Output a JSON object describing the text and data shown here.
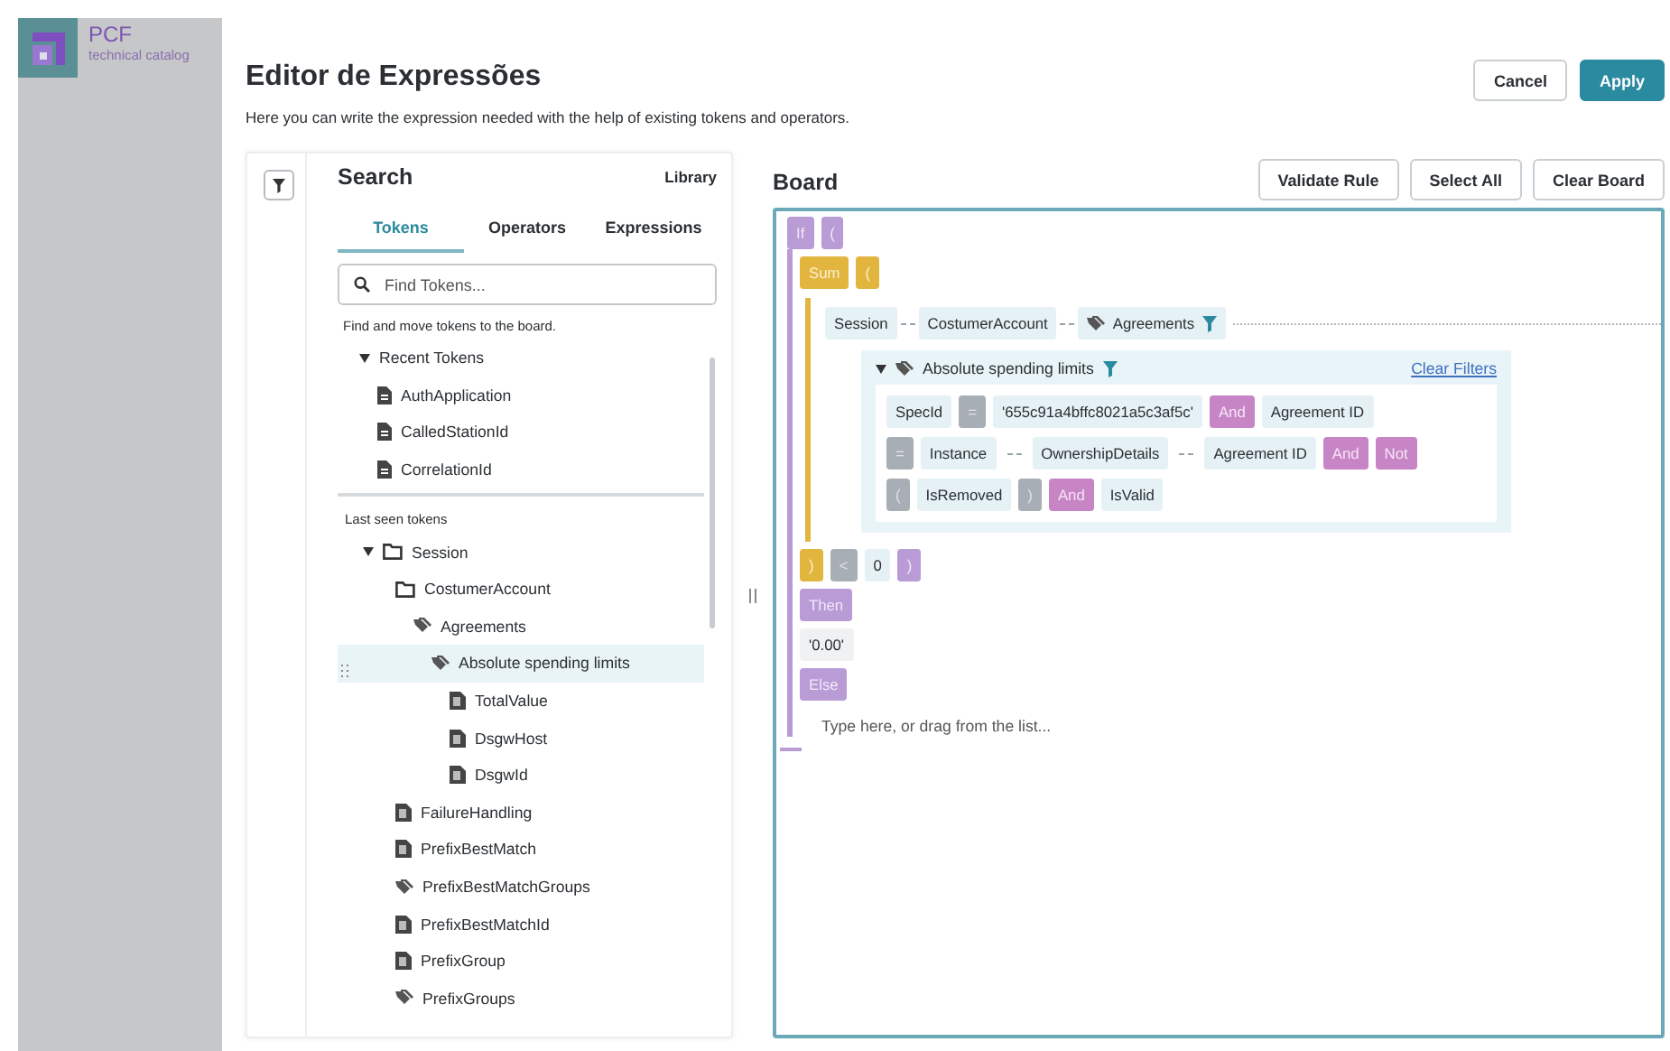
{
  "app": {
    "logo_title": "PCF",
    "logo_subtitle": "technical catalog"
  },
  "header": {
    "title": "Editor de Expressões",
    "subtitle": "Here you can write the expression needed with the help of existing tokens and operators.",
    "buttons": [
      {
        "label": "Cancel",
        "kind": "secondary"
      },
      {
        "label": "Apply",
        "kind": "primary"
      }
    ]
  },
  "search": {
    "title": "Search",
    "library": "Library",
    "tabs": [
      {
        "label": "Tokens",
        "selected": true
      },
      {
        "label": "Operators",
        "selected": false
      },
      {
        "label": "Expressions",
        "selected": false
      }
    ],
    "placeholder": "Find Tokens...",
    "hint": "Find and move tokens to the board.",
    "recent": {
      "label": "Recent Tokens",
      "expanded": true,
      "items": [
        {
          "label": "AuthApplication",
          "kind": "doc",
          "selected": false
        },
        {
          "label": "CalledStationId",
          "kind": "doc",
          "selected": false
        },
        {
          "label": "CorrelationId",
          "kind": "doc",
          "selected": false
        }
      ]
    },
    "last_seen_label": "Last seen tokens",
    "tree": [
      {
        "label": "Session",
        "kind": "folder",
        "expanded": true,
        "selected": false,
        "children": [
          {
            "label": "CostumerAccount",
            "kind": "folder",
            "selected": false,
            "children": [
              {
                "label": "Agreements",
                "kind": "tag",
                "selected": false,
                "children": [
                  {
                    "label": "Absolute spending limits",
                    "kind": "tag",
                    "selected": true,
                    "children": [
                      {
                        "label": "TotalValue",
                        "kind": "field",
                        "selected": false
                      },
                      {
                        "label": "DsgwHost",
                        "kind": "field",
                        "selected": false
                      },
                      {
                        "label": "DsgwId",
                        "kind": "field",
                        "selected": false
                      }
                    ]
                  }
                ]
              }
            ]
          },
          {
            "label": "FailureHandling",
            "kind": "field",
            "selected": false
          },
          {
            "label": "PrefixBestMatch",
            "kind": "field",
            "selected": false
          },
          {
            "label": "PrefixBestMatchGroups",
            "kind": "tag",
            "selected": false
          },
          {
            "label": "PrefixBestMatchId",
            "kind": "field",
            "selected": false
          },
          {
            "label": "PrefixGroup",
            "kind": "field",
            "selected": false
          },
          {
            "label": "PrefixGroups",
            "kind": "tag",
            "selected": false
          }
        ]
      }
    ]
  },
  "board": {
    "title": "Board",
    "buttons": [
      "Validate Rule",
      "Select All",
      "Clear Board"
    ],
    "if": {
      "keyword": "If",
      "open": "(",
      "close": ")",
      "then": "Then",
      "then_value": "'0.00'",
      "else": "Else",
      "else_placeholder": "Type here, or drag from the list..."
    },
    "sum": {
      "keyword": "Sum",
      "open": "(",
      "close": ")"
    },
    "path": [
      {
        "text": "Session",
        "kind": "field"
      },
      {
        "text": "CostumerAccount",
        "kind": "field"
      },
      {
        "text": "Agreements",
        "kind": "tag",
        "filtered": true
      }
    ],
    "filter": {
      "title": "Absolute spending limits",
      "expanded": true,
      "filtered": true,
      "clear": "Clear Filters",
      "rows": [
        {
          "tokens": [
            {
              "text": "SpecId",
              "kind": "field"
            },
            {
              "text": "=",
              "kind": "op"
            },
            {
              "text": "'655c91a4bffc8021a5c3af5c'",
              "kind": "field"
            },
            {
              "text": "And",
              "kind": "logic"
            },
            {
              "text": "Agreement ID",
              "kind": "field"
            }
          ]
        },
        {
          "tokens": [
            {
              "text": "=",
              "kind": "op"
            },
            {
              "text": "Instance",
              "kind": "field"
            },
            {
              "text": "OwnershipDetails",
              "kind": "link"
            },
            {
              "text": "Agreement ID",
              "kind": "link"
            },
            {
              "text": "And",
              "kind": "logic"
            },
            {
              "text": "Not",
              "kind": "logic"
            }
          ]
        },
        {
          "tokens": [
            {
              "text": "(",
              "kind": "op"
            },
            {
              "text": "IsRemoved",
              "kind": "field"
            },
            {
              "text": ")",
              "kind": "op"
            },
            {
              "text": "And",
              "kind": "logic"
            },
            {
              "text": "IsValid",
              "kind": "field"
            }
          ]
        }
      ]
    },
    "comparison": [
      {
        "text": "<",
        "kind": "op"
      },
      {
        "text": "0",
        "kind": "field"
      }
    ]
  }
}
